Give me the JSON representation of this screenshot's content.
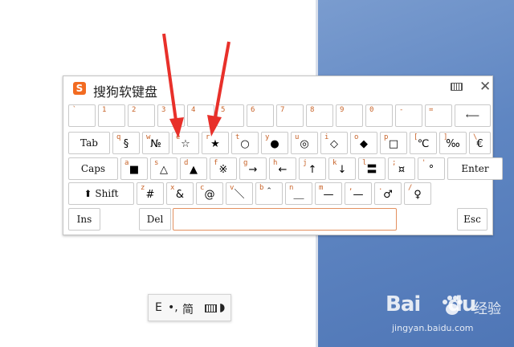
{
  "keyboard": {
    "title": "搜狗软键盘",
    "logo_letter": "S",
    "close_symbol": "✕",
    "rows": [
      [
        {
          "shift": "`",
          "main": ""
        },
        {
          "shift": "1",
          "main": ""
        },
        {
          "shift": "2",
          "main": ""
        },
        {
          "shift": "3",
          "main": ""
        },
        {
          "shift": "4",
          "main": ""
        },
        {
          "shift": "5",
          "main": ""
        },
        {
          "shift": "6",
          "main": ""
        },
        {
          "shift": "7",
          "main": ""
        },
        {
          "shift": "8",
          "main": ""
        },
        {
          "shift": "9",
          "main": ""
        },
        {
          "shift": "0",
          "main": ""
        },
        {
          "shift": "-",
          "main": ""
        },
        {
          "shift": "=",
          "main": ""
        },
        {
          "fn": "⟵"
        }
      ],
      [
        {
          "fn": "Tab"
        },
        {
          "shift": "q",
          "main": "§"
        },
        {
          "shift": "w",
          "main": "№"
        },
        {
          "shift": "e",
          "main": "☆"
        },
        {
          "shift": "r",
          "main": "★"
        },
        {
          "shift": "t",
          "main": "○"
        },
        {
          "shift": "y",
          "main": "●"
        },
        {
          "shift": "u",
          "main": "◎"
        },
        {
          "shift": "i",
          "main": "◇"
        },
        {
          "shift": "o",
          "main": "◆"
        },
        {
          "shift": "p",
          "main": "□"
        },
        {
          "shift": "[",
          "main": "℃"
        },
        {
          "shift": "]",
          "main": "‰"
        },
        {
          "shift": "\\",
          "main": "€"
        }
      ],
      [
        {
          "fn": "Caps"
        },
        {
          "shift": "a",
          "main": "■"
        },
        {
          "shift": "s",
          "main": "△"
        },
        {
          "shift": "d",
          "main": "▲"
        },
        {
          "shift": "f",
          "main": "※"
        },
        {
          "shift": "g",
          "main": "→"
        },
        {
          "shift": "h",
          "main": "←"
        },
        {
          "shift": "j",
          "main": "↑"
        },
        {
          "shift": "k",
          "main": "↓"
        },
        {
          "shift": "l",
          "main": "〓"
        },
        {
          "shift": ";",
          "main": "¤"
        },
        {
          "shift": "'",
          "main": "°"
        },
        {
          "fn": "Enter"
        }
      ],
      [
        {
          "fn": "⬆ Shift"
        },
        {
          "shift": "z",
          "main": "#"
        },
        {
          "shift": "x",
          "main": "&"
        },
        {
          "shift": "c",
          "main": "@"
        },
        {
          "shift": "v",
          "main": "＼"
        },
        {
          "shift": "b",
          "main": "＾"
        },
        {
          "shift": "n",
          "main": "＿"
        },
        {
          "shift": "m",
          "main": "—"
        },
        {
          "shift": ",",
          "main": "—"
        },
        {
          "shift": ".",
          "main": "♂"
        },
        {
          "shift": "/",
          "main": "♀"
        }
      ],
      [
        {
          "fn": "Ins"
        },
        {
          "fn": "Del"
        },
        {
          "fn": "Esc"
        }
      ]
    ]
  },
  "ime_bar": {
    "items": [
      "E",
      "•,",
      "简",
      "",
      "◗"
    ]
  },
  "watermark": {
    "brand": "Bai",
    "brand_tail": "du",
    "cn": "经验",
    "url": "jingyan.baidu.com"
  },
  "colors": {
    "arrow": "#e8302a",
    "shift_label": "#c8642a",
    "logo": "#f26b21",
    "desktop": "#5f86c2"
  }
}
